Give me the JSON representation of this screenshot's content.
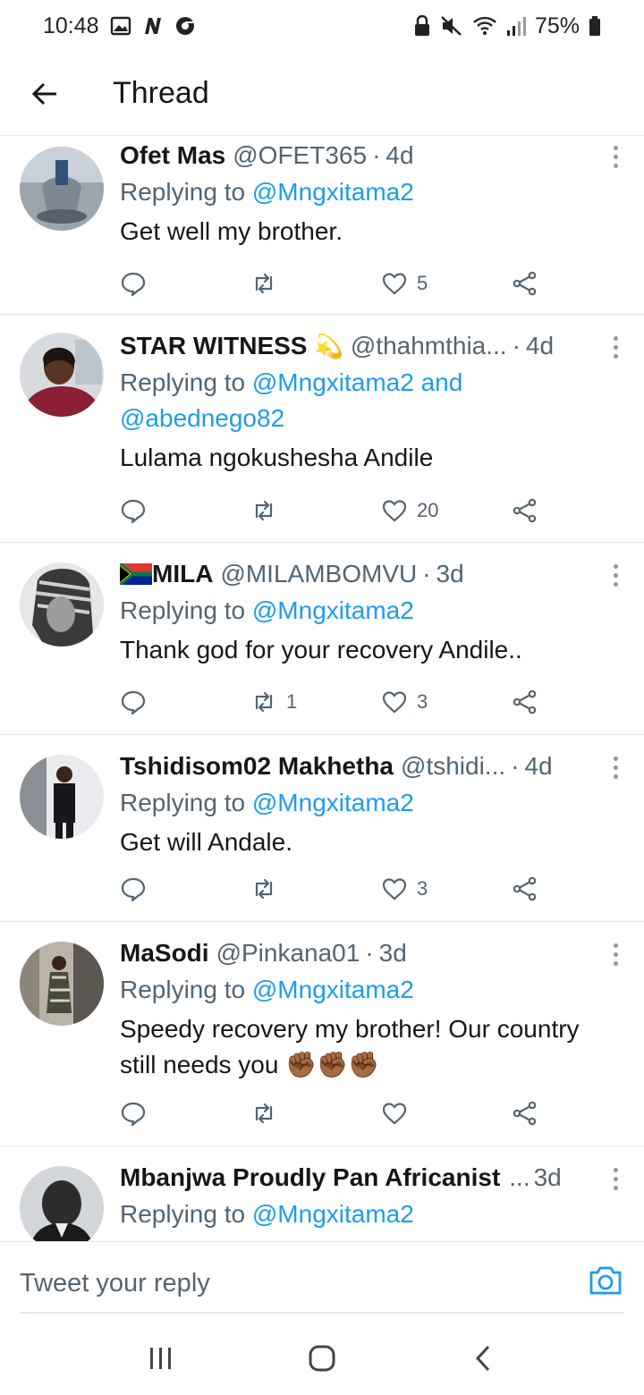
{
  "status_bar": {
    "time": "10:48",
    "battery": "75%",
    "left_icons": [
      "gallery-icon",
      "n-app-icon",
      "browser-icon"
    ],
    "right_icons": [
      "lock-icon",
      "mute-icon",
      "wifi-icon",
      "signal-icon",
      "battery-icon"
    ]
  },
  "header": {
    "title": "Thread",
    "back_icon": "back-arrow-icon"
  },
  "tweets": [
    {
      "display_name": "Ofet Mas",
      "handle": "@OFET365",
      "time": "4d",
      "replying_label": "Replying to",
      "mentions": "@Mngxitama2",
      "text": "Get well my brother.",
      "retweets": "",
      "likes": "5"
    },
    {
      "display_name": "STAR WITNESS",
      "name_emoji": "💫",
      "handle": "@thahmthia...",
      "time": "4d",
      "replying_label": "Replying to",
      "mentions": "@Mngxitama2",
      "mentions_join": "and",
      "mentions_2": "@abednego82",
      "text": "Lulama ngokushesha Andile",
      "retweets": "",
      "likes": "20"
    },
    {
      "display_name": "MILA",
      "name_flag": "south-africa-flag",
      "handle": "@MILAMBOMVU",
      "time": "3d",
      "replying_label": "Replying to",
      "mentions": "@Mngxitama2",
      "text": "Thank god for your recovery Andile..",
      "retweets": "1",
      "likes": "3"
    },
    {
      "display_name": "Tshidisom02 Makhetha",
      "handle": "@tshidi...",
      "time": "4d",
      "replying_label": "Replying to",
      "mentions": "@Mngxitama2",
      "text": "Get will Andale.",
      "retweets": "",
      "likes": "3"
    },
    {
      "display_name": "MaSodi",
      "handle": "@Pinkana01",
      "time": "3d",
      "replying_label": "Replying to",
      "mentions": "@Mngxitama2",
      "text_line1": "Speedy recovery my brother! Our country",
      "text_line2": "still needs you",
      "text_emoji": "✊🏾✊🏾✊🏾",
      "retweets": "",
      "likes": ""
    },
    {
      "display_name": "Mbanjwa Proudly Pan Africanist",
      "handle": "...",
      "time": "3d",
      "replying_label": "Replying to",
      "mentions": "@Mngxitama2"
    }
  ],
  "reply_bar": {
    "placeholder": "Tweet your reply",
    "camera_icon": "camera-icon"
  },
  "nav_bar": {
    "icons": [
      "recent-apps-icon",
      "home-icon",
      "back-icon"
    ]
  },
  "colors": {
    "accent": "#1d9bf0",
    "secondary_text": "#536471",
    "primary_text": "#14171a",
    "divider": "#e1e8ed"
  }
}
